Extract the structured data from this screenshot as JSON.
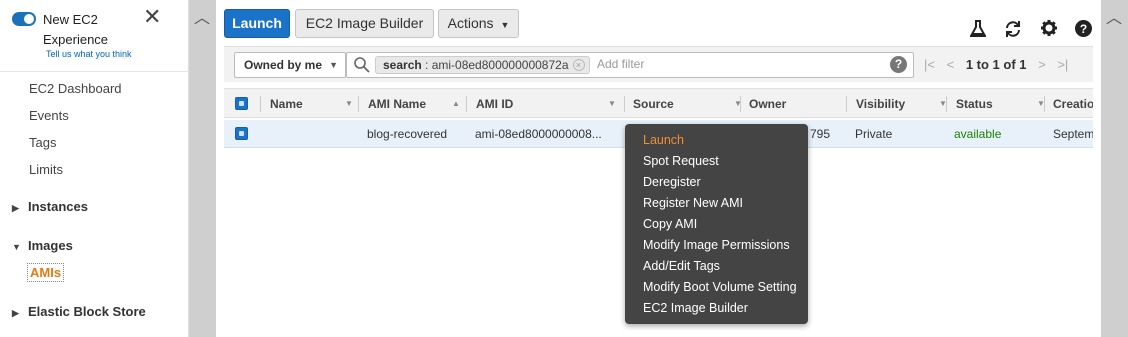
{
  "sidebar": {
    "toggle_title": "New EC2 Experience",
    "toggle_subtitle": "Tell us what you think",
    "close_symbol": "✕",
    "items": [
      {
        "label": "EC2 Dashboard"
      },
      {
        "label": "Events"
      },
      {
        "label": "Tags"
      },
      {
        "label": "Limits"
      }
    ],
    "sections": [
      {
        "label": "Instances",
        "expanded": false
      },
      {
        "label": "Images",
        "expanded": true
      },
      {
        "label": "Elastic Block Store",
        "expanded": false
      }
    ],
    "active_item": "AMIs"
  },
  "toolbar": {
    "launch_label": "Launch",
    "image_builder_label": "EC2 Image Builder",
    "actions_label": "Actions",
    "icons": [
      "flask-icon",
      "refresh-icon",
      "gear-icon",
      "help-icon"
    ]
  },
  "filter": {
    "owned_label": "Owned by me",
    "chip_key": "search",
    "chip_value": " : ami-08ed800000000872a",
    "add_filter_placeholder": "Add filter",
    "pager_text": "1 to 1 of 1"
  },
  "table": {
    "columns": [
      {
        "label": "Name"
      },
      {
        "label": "AMI Name"
      },
      {
        "label": "AMI ID"
      },
      {
        "label": "Source"
      },
      {
        "label": "Owner"
      },
      {
        "label": "Visibility"
      },
      {
        "label": "Status"
      },
      {
        "label": "Creatio"
      }
    ],
    "row": {
      "name": "",
      "ami_name": "blog-recovered",
      "ami_id": "ami-08ed8000000008...",
      "source": "",
      "owner": "795",
      "visibility": "Private",
      "status": "available",
      "creation": "Septem"
    }
  },
  "context_menu": {
    "items": [
      {
        "label": "Launch",
        "active": true
      },
      {
        "label": "Spot Request"
      },
      {
        "label": "Deregister"
      },
      {
        "label": "Register New AMI"
      },
      {
        "label": "Copy AMI"
      },
      {
        "label": "Modify Image Permissions"
      },
      {
        "label": "Add/Edit Tags"
      },
      {
        "label": "Modify Boot Volume Setting"
      },
      {
        "label": "EC2 Image Builder"
      }
    ]
  },
  "colors": {
    "primary": "#1a73c9",
    "active_orange": "#e47911",
    "status_green": "#1d8102",
    "menu_bg": "#444444"
  }
}
